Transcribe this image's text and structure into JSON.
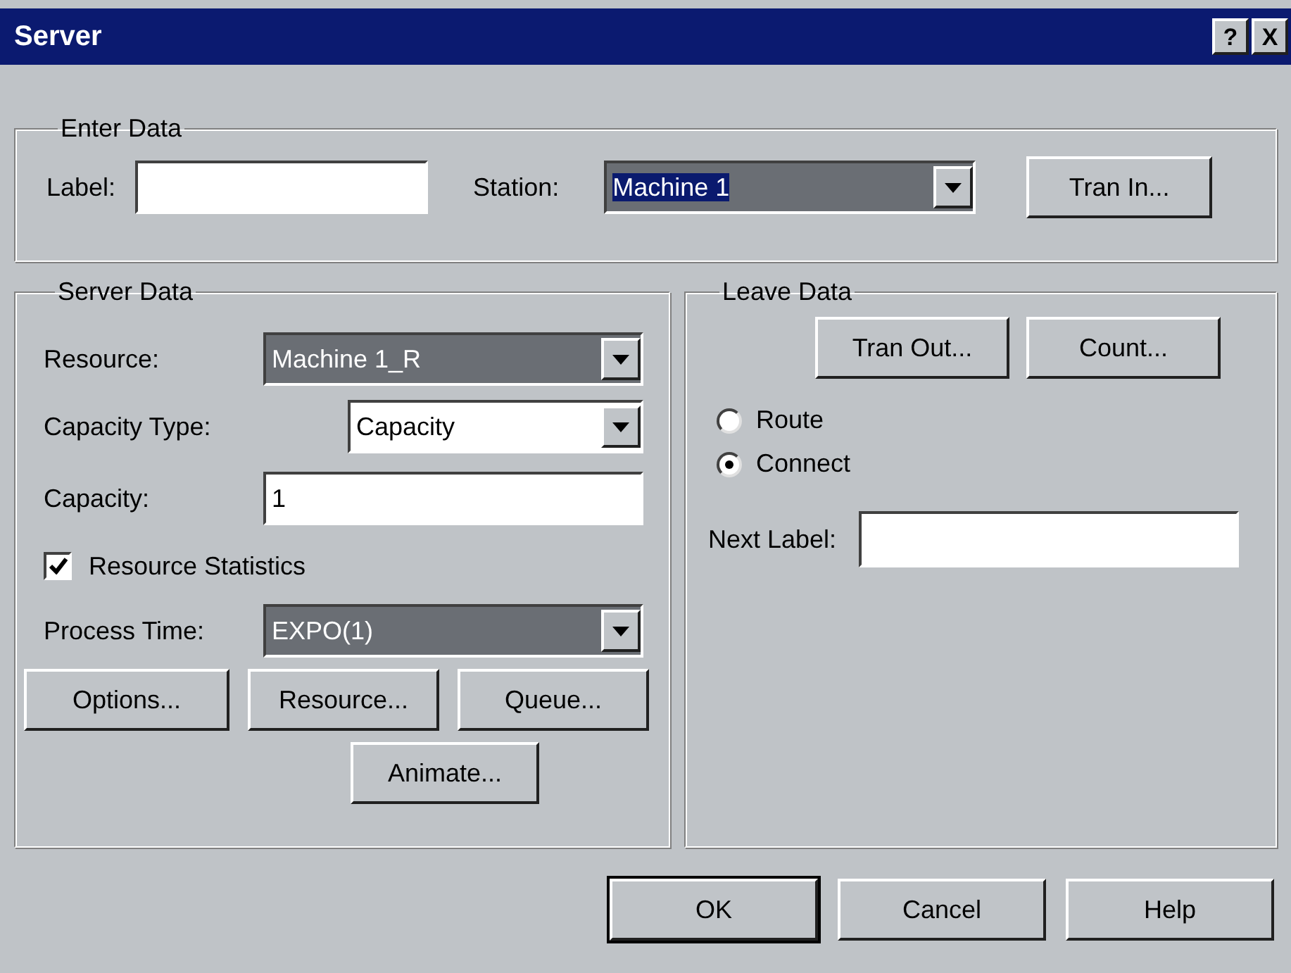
{
  "window": {
    "title": "Server",
    "title_buttons": [
      "?",
      "X"
    ]
  },
  "enter_data": {
    "title": "Enter Data",
    "label_field": {
      "label": "Label:"
    },
    "station": {
      "label": "Station:",
      "value": "Machine 1",
      "highlighted": true,
      "text_selected": true
    },
    "button": {
      "label": "Tran In..."
    }
  },
  "server_data": {
    "title": "Server Data",
    "resource": {
      "label": "Resource:",
      "value": "Machine 1_R",
      "highlighted": true,
      "text_selected": false
    },
    "capacity_type": {
      "label": "Capacity Type:",
      "value": "Capacity",
      "highlighted": false,
      "text_selected": false
    },
    "capacity": {
      "label": "Capacity:",
      "value": "1"
    },
    "resource_statistics": {
      "label": "Resource Statistics",
      "checked": true
    },
    "process_time": {
      "label": "Process Time:",
      "value": "EXPO(1)",
      "highlighted": true,
      "text_selected": false
    },
    "buttons": [
      {
        "label": "Options..."
      },
      {
        "label": "Resource..."
      },
      {
        "label": "Queue..."
      },
      {
        "label": "Animate..."
      }
    ]
  },
  "leave_data": {
    "title": "Leave Data",
    "buttons": [
      {
        "label": "Tran Out..."
      },
      {
        "label": "Count..."
      }
    ],
    "options": [
      {
        "label": "Route",
        "selected": false
      },
      {
        "label": "Connect",
        "selected": true
      }
    ],
    "next_label": {
      "label": "Next Label:"
    }
  },
  "footer_buttons": [
    {
      "label": "OK",
      "default": true
    },
    {
      "label": "Cancel",
      "default": false
    },
    {
      "label": "Help",
      "default": false
    }
  ]
}
